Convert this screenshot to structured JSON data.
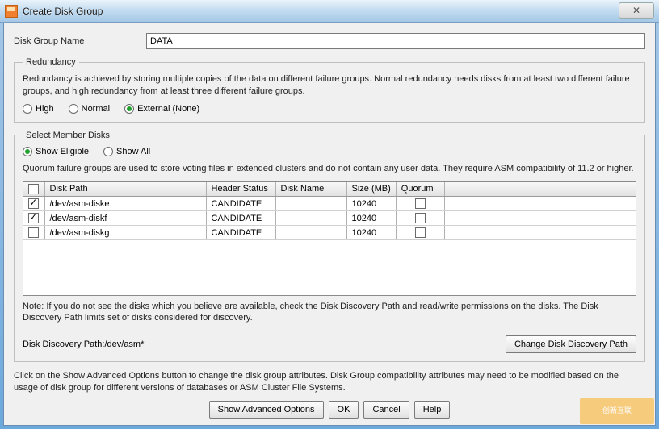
{
  "window": {
    "title": "Create Disk Group"
  },
  "name_field": {
    "label": "Disk Group Name",
    "value": "DATA"
  },
  "redundancy": {
    "legend": "Redundancy",
    "desc": "Redundancy is achieved by storing multiple copies of the data on different failure groups. Normal redundancy needs disks from at least two different failure groups, and high redundancy from at least three different failure groups.",
    "options": {
      "high": "High",
      "normal": "Normal",
      "external": "External (None)"
    }
  },
  "members": {
    "legend": "Select Member Disks",
    "show_eligible": "Show Eligible",
    "show_all": "Show All",
    "quorum_desc": "Quorum failure groups are used to store voting files in extended clusters and do not contain any user data. They require ASM compatibility of 11.2 or higher.",
    "headers": {
      "path": "Disk Path",
      "header_status": "Header Status",
      "disk_name": "Disk Name",
      "size": "Size (MB)",
      "quorum": "Quorum"
    },
    "rows": [
      {
        "checked": true,
        "path": "/dev/asm-diske",
        "header_status": "CANDIDATE",
        "disk_name": "",
        "size": "10240",
        "quorum_checked": false
      },
      {
        "checked": true,
        "path": "/dev/asm-diskf",
        "header_status": "CANDIDATE",
        "disk_name": "",
        "size": "10240",
        "quorum_checked": false
      },
      {
        "checked": false,
        "path": "/dev/asm-diskg",
        "header_status": "CANDIDATE",
        "disk_name": "",
        "size": "10240",
        "quorum_checked": false
      }
    ],
    "note": "Note: If you do not see the disks which you believe are available, check the Disk Discovery Path and read/write permissions on the disks. The Disk Discovery Path limits set of disks considered for discovery.",
    "discovery_label": "Disk Discovery Path:/dev/asm*",
    "change_path_btn": "Change Disk Discovery Path"
  },
  "footer": {
    "desc": "Click on the Show Advanced Options button to change the disk group attributes. Disk Group compatibility attributes may need to be modified based on the usage of disk group for different versions of databases or ASM Cluster File Systems.",
    "adv_btn": "Show Advanced Options",
    "ok": "OK",
    "cancel": "Cancel",
    "help": "Help"
  },
  "watermark": "创新互联"
}
